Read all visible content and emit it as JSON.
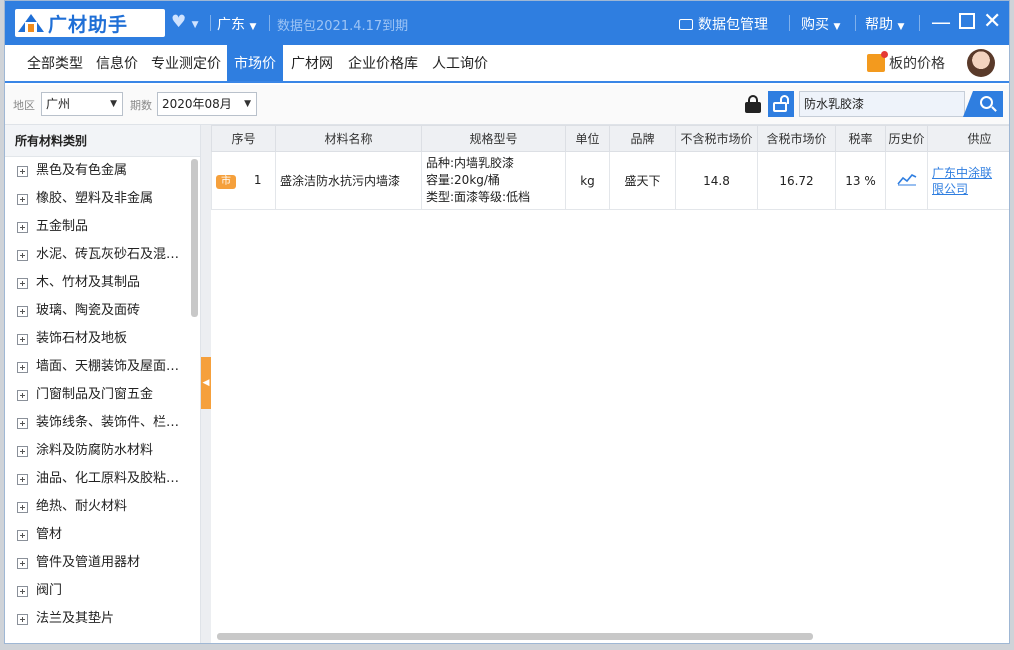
{
  "app": {
    "title": "广材助手",
    "region_menu": "广东",
    "data_package": "数据包2021.4.17到期",
    "package_mgmt": "数据包管理",
    "buy": "购买",
    "help": "帮助",
    "accent": "#2f7ee0"
  },
  "tabs": [
    {
      "label": "全部类型"
    },
    {
      "label": "信息价"
    },
    {
      "label": "专业测定价"
    },
    {
      "label": "市场价",
      "active": true
    },
    {
      "label": "广材网"
    },
    {
      "label": "企业价格库"
    },
    {
      "label": "人工询价"
    }
  ],
  "promo": {
    "label": "板的价格"
  },
  "filters": {
    "region_label": "地区",
    "region_value": "广州",
    "period_label": "期数",
    "period_value": "2020年08月",
    "search_value": "防水乳胶漆"
  },
  "sidebar": {
    "title": "所有材料类别",
    "items": [
      "黑色及有色金属",
      "橡胶、塑料及非金属",
      "五金制品",
      "水泥、砖瓦灰砂石及混…",
      "木、竹材及其制品",
      "玻璃、陶瓷及面砖",
      "装饰石材及地板",
      "墙面、天棚装饰及屋面…",
      "门窗制品及门窗五金",
      "装饰线条、装饰件、栏…",
      "涂料及防腐防水材料",
      "油品、化工原料及胶粘…",
      "绝热、耐火材料",
      "管材",
      "管件及管道用器材",
      "阀门",
      "法兰及其垫片"
    ]
  },
  "table": {
    "headers": {
      "seq": "序号",
      "name": "材料名称",
      "spec": "规格型号",
      "unit": "单位",
      "brand": "品牌",
      "price_ex": "不含税市场价",
      "price_inc": "含税市场价",
      "tax": "税率",
      "history": "历史价",
      "supplier": "供应"
    },
    "row": {
      "badge": "市",
      "seq": "1",
      "name": "盛涂洁防水抗污内墙漆",
      "spec_1": "品种:内墙乳胶漆",
      "spec_2": "容量:20kg/桶",
      "spec_3": "类型:面漆等级:低档",
      "unit": "kg",
      "brand": "盛天下",
      "price_ex": "14.8",
      "price_inc": "16.72",
      "tax": "13 %",
      "supplier_1": "广东中涂联",
      "supplier_2": "限公司"
    }
  }
}
